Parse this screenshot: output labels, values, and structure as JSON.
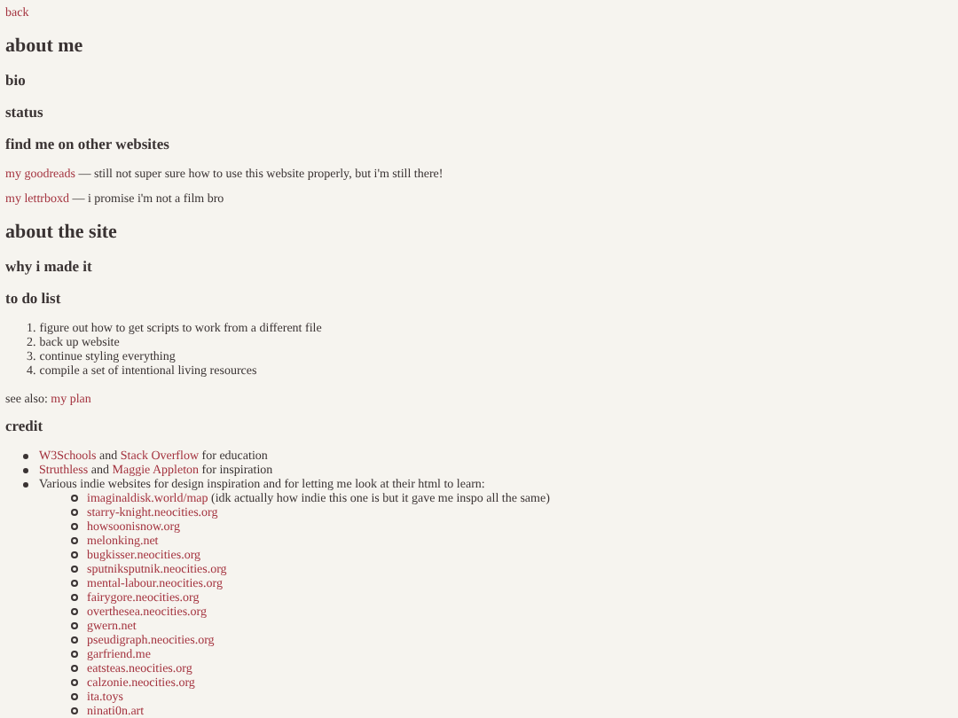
{
  "back_link": "back",
  "sections": [
    {
      "title": "about me",
      "subsections": [
        {
          "title": "bio"
        },
        {
          "title": "status"
        },
        {
          "title": "find me on other websites",
          "paragraphs": [
            [
              {
                "kind": "link",
                "text": "my goodreads"
              },
              {
                "kind": "text",
                "text": " — still not super sure how to use this website properly, but i'm still there!"
              }
            ],
            [
              {
                "kind": "link",
                "text": "my lettrboxd"
              },
              {
                "kind": "text",
                "text": " — i promise i'm not a film bro"
              }
            ]
          ]
        }
      ]
    },
    {
      "title": "about the site",
      "subsections": [
        {
          "title": "why i made it"
        },
        {
          "title": "to do list",
          "ordered": [
            {
              "number": "1.",
              "text": "figure out how to get scripts to work from a different file"
            },
            {
              "number": "2.",
              "text": "back up website"
            },
            {
              "number": "3.",
              "text": "continue styling everything"
            },
            {
              "number": "4.",
              "text": "compile a set of intentional living resources"
            }
          ],
          "paragraphs": [
            [
              {
                "kind": "text",
                "text": "see also: "
              },
              {
                "kind": "link",
                "text": "my plan"
              }
            ]
          ]
        },
        {
          "title": "credit",
          "bullets": [
            {
              "parts": [
                {
                  "kind": "link",
                  "text": "W3Schools"
                },
                {
                  "kind": "text",
                  "text": " and "
                },
                {
                  "kind": "link",
                  "text": "Stack Overflow"
                },
                {
                  "kind": "text",
                  "text": " for education"
                }
              ]
            },
            {
              "parts": [
                {
                  "kind": "link",
                  "text": "Struthless"
                },
                {
                  "kind": "text",
                  "text": " and "
                },
                {
                  "kind": "link",
                  "text": "Maggie Appleton"
                },
                {
                  "kind": "text",
                  "text": " for inspiration"
                }
              ]
            },
            {
              "parts": [
                {
                  "kind": "text",
                  "text": "Various indie websites for design inspiration and for letting me look at their html to learn:"
                }
              ],
              "children": [
                {
                  "parts": [
                    {
                      "kind": "link",
                      "text": "imaginaldisk.world/map"
                    },
                    {
                      "kind": "text",
                      "text": " (idk actually how indie this one is but it gave me inspo all the same)"
                    }
                  ]
                },
                {
                  "parts": [
                    {
                      "kind": "link",
                      "text": "starry-knight.neocities.org"
                    }
                  ]
                },
                {
                  "parts": [
                    {
                      "kind": "link",
                      "text": "howsoonisnow.org"
                    }
                  ]
                },
                {
                  "parts": [
                    {
                      "kind": "link",
                      "text": "melonking.net"
                    }
                  ]
                },
                {
                  "parts": [
                    {
                      "kind": "link",
                      "text": "bugkisser.neocities.org"
                    }
                  ]
                },
                {
                  "parts": [
                    {
                      "kind": "link",
                      "text": "sputniksputnik.neocities.org"
                    }
                  ]
                },
                {
                  "parts": [
                    {
                      "kind": "link",
                      "text": "mental-labour.neocities.org"
                    }
                  ]
                },
                {
                  "parts": [
                    {
                      "kind": "link",
                      "text": "fairygore.neocities.org"
                    }
                  ]
                },
                {
                  "parts": [
                    {
                      "kind": "link",
                      "text": "overthesea.neocities.org"
                    }
                  ]
                },
                {
                  "parts": [
                    {
                      "kind": "link",
                      "text": "gwern.net"
                    }
                  ]
                },
                {
                  "parts": [
                    {
                      "kind": "link",
                      "text": "pseudigraph.neocities.org"
                    }
                  ]
                },
                {
                  "parts": [
                    {
                      "kind": "link",
                      "text": "garfriend.me"
                    }
                  ]
                },
                {
                  "parts": [
                    {
                      "kind": "link",
                      "text": "eatsteas.neocities.org"
                    }
                  ]
                },
                {
                  "parts": [
                    {
                      "kind": "link",
                      "text": "calzonie.neocities.org"
                    }
                  ]
                },
                {
                  "parts": [
                    {
                      "kind": "link",
                      "text": "ita.toys"
                    }
                  ]
                },
                {
                  "parts": [
                    {
                      "kind": "link",
                      "text": "ninati0n.art"
                    }
                  ]
                }
              ]
            }
          ]
        }
      ]
    }
  ]
}
